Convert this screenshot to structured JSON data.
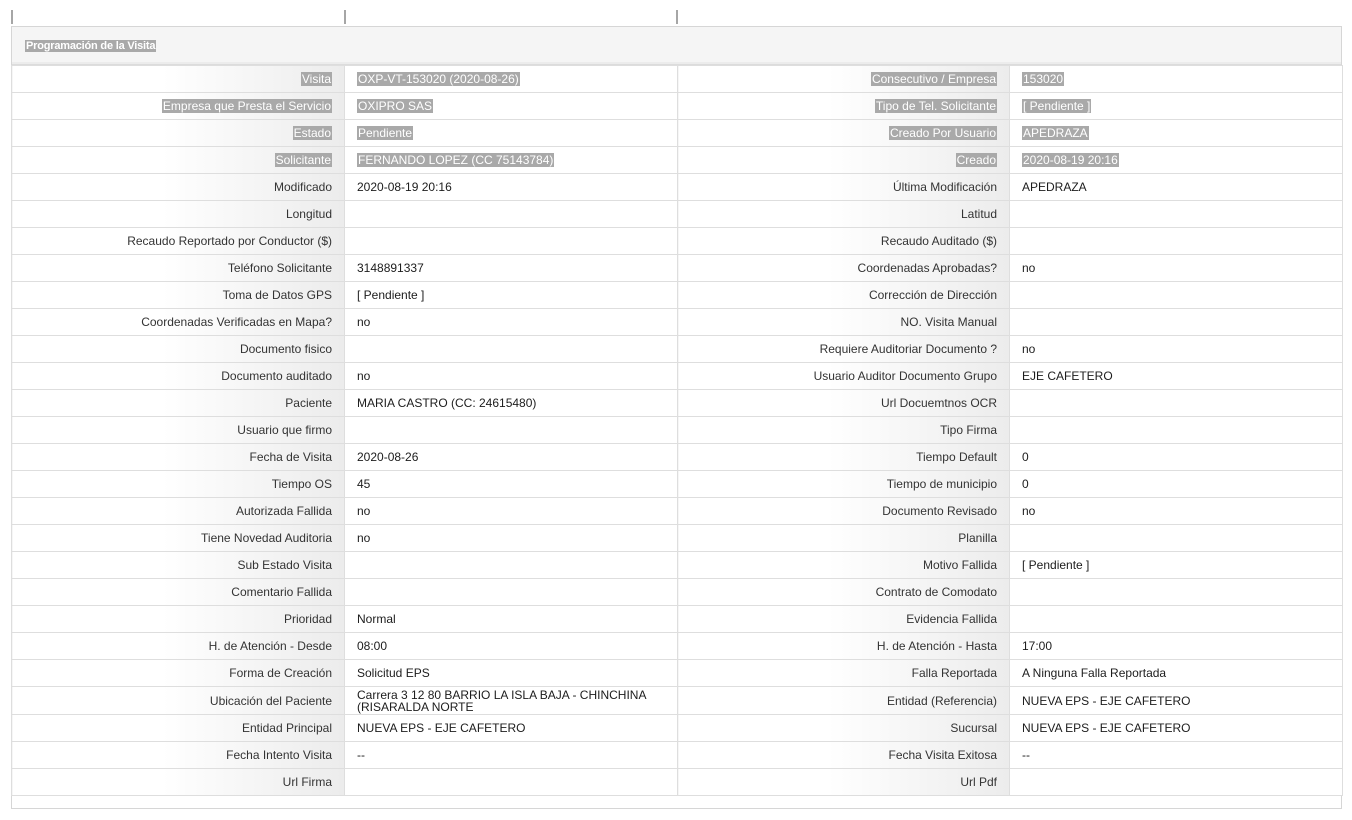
{
  "header": {
    "title": "Programación de la Visita"
  },
  "rows": [
    {
      "l1": "Visita",
      "v1": "OXP-VT-153020 (2020-08-26)",
      "l2": "Consecutivo / Empresa",
      "v2": "153020",
      "hl": true
    },
    {
      "l1": "Empresa que Presta el Servicio",
      "v1": "OXIPRO SAS",
      "l2": "Tipo de Tel. Solicitante",
      "v2": "[ Pendiente ]",
      "hl": true
    },
    {
      "l1": "Estado",
      "v1": "Pendiente",
      "l2": "Creado Por Usuario",
      "v2": "APEDRAZA",
      "hl": true
    },
    {
      "l1": "Solicitante",
      "v1": "FERNANDO LOPEZ (CC 75143784)",
      "l2": "Creado",
      "v2": "2020-08-19 20:16",
      "hl": true
    },
    {
      "l1": "Modificado",
      "v1": "2020-08-19 20:16",
      "l2": "Última Modificación",
      "v2": "APEDRAZA"
    },
    {
      "l1": "Longitud",
      "v1": "",
      "l2": "Latitud",
      "v2": ""
    },
    {
      "l1": "Recaudo Reportado por Conductor ($)",
      "v1": "",
      "l2": "Recaudo Auditado ($)",
      "v2": ""
    },
    {
      "l1": "Teléfono Solicitante",
      "v1": "3148891337",
      "l2": "Coordenadas Aprobadas?",
      "v2": "no"
    },
    {
      "l1": "Toma de Datos GPS",
      "v1": "[ Pendiente ]",
      "l2": "Corrección de Dirección",
      "v2": ""
    },
    {
      "l1": "Coordenadas Verificadas en Mapa?",
      "v1": "no",
      "l2": "NO. Visita Manual",
      "v2": ""
    },
    {
      "l1": "Documento fisico",
      "v1": "",
      "l2": "Requiere Auditoriar Documento ?",
      "v2": "no"
    },
    {
      "l1": "Documento auditado",
      "v1": "no",
      "l2": "Usuario Auditor Documento Grupo",
      "v2": "EJE CAFETERO"
    },
    {
      "l1": "Paciente",
      "v1": "MARIA CASTRO (CC: 24615480)",
      "l2": "Url Docuemtnos OCR",
      "v2": ""
    },
    {
      "l1": "Usuario que firmo",
      "v1": "",
      "l2": "Tipo Firma",
      "v2": ""
    },
    {
      "l1": "Fecha de Visita",
      "v1": "2020-08-26",
      "l2": "Tiempo Default",
      "v2": "0"
    },
    {
      "l1": "Tiempo OS",
      "v1": "45",
      "l2": "Tiempo de municipio",
      "v2": "0"
    },
    {
      "l1": "Autorizada Fallida",
      "v1": "no",
      "l2": "Documento Revisado",
      "v2": "no"
    },
    {
      "l1": "Tiene Novedad Auditoria",
      "v1": "no",
      "l2": "Planilla",
      "v2": ""
    },
    {
      "l1": "Sub Estado Visita",
      "v1": "",
      "l2": "Motivo Fallida",
      "v2": "[ Pendiente ]"
    },
    {
      "l1": "Comentario Fallida",
      "v1": "",
      "l2": "Contrato de Comodato",
      "v2": ""
    },
    {
      "l1": "Prioridad",
      "v1": "Normal",
      "l2": "Evidencia Fallida",
      "v2": ""
    },
    {
      "l1": "H. de Atención - Desde",
      "v1": "08:00",
      "l2": "H. de Atención - Hasta",
      "v2": "17:00"
    },
    {
      "l1": "Forma de Creación",
      "v1": "Solicitud EPS",
      "l2": "Falla Reportada",
      "v2": "A Ninguna Falla Reportada"
    },
    {
      "l1": "Ubicación del Paciente",
      "v1": "Carrera 3 12 80 BARRIO LA ISLA BAJA - CHINCHINA (RISARALDA NORTE",
      "l2": "Entidad (Referencia)",
      "v2": "NUEVA EPS - EJE CAFETERO",
      "tall": true
    },
    {
      "l1": "Entidad Principal",
      "v1": "NUEVA EPS - EJE CAFETERO",
      "l2": "Sucursal",
      "v2": "NUEVA EPS - EJE CAFETERO"
    },
    {
      "l1": "Fecha Intento Visita",
      "v1": "--",
      "l2": "Fecha Visita Exitosa",
      "v2": "--"
    },
    {
      "l1": "Url Firma",
      "v1": "",
      "l2": "Url Pdf",
      "v2": ""
    }
  ]
}
